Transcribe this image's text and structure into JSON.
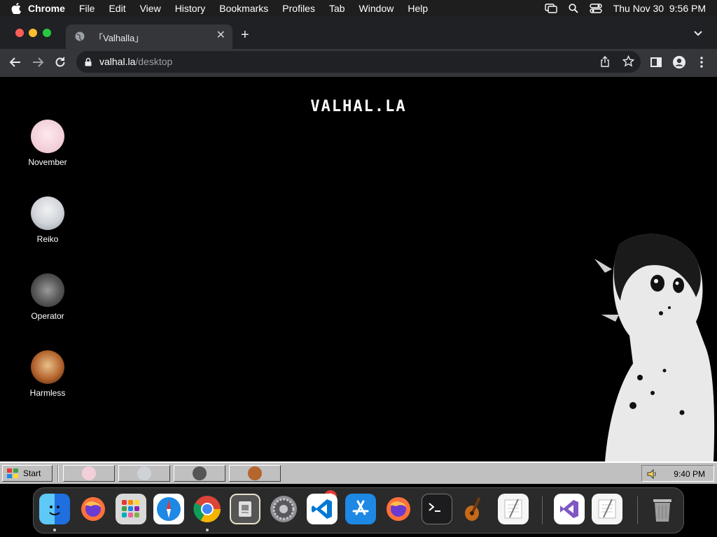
{
  "menubar": {
    "app_name": "Chrome",
    "items": [
      "File",
      "Edit",
      "View",
      "History",
      "Bookmarks",
      "Profiles",
      "Tab",
      "Window",
      "Help"
    ],
    "datetime": "Thu Nov 30  9:56 PM"
  },
  "browser": {
    "tab_title": "「Valhalla」",
    "url_host": "valhal.la",
    "url_path": "/desktop"
  },
  "page": {
    "title": "VALHAL.LA",
    "desktop_icons": [
      {
        "label": "November",
        "color": "#f3d6de"
      },
      {
        "label": "Reiko",
        "color": "#cfd3d8"
      },
      {
        "label": "Operator",
        "color": "#555555"
      },
      {
        "label": "Harmless",
        "color": "#b5652e"
      }
    ]
  },
  "taskbar": {
    "start_label": "Start",
    "clock": "9:40 PM",
    "windows": [
      "november",
      "reiko",
      "operator",
      "harmless"
    ]
  },
  "dock": {
    "apps": [
      "finder-icon",
      "firefox-icon",
      "launchpad-icon",
      "safari-icon",
      "chrome-icon",
      "preview-icon",
      "system-settings-icon",
      "vscode-icon",
      "app-store-icon",
      "firefox-icon",
      "terminal-icon",
      "garageband-icon",
      "textedit-icon",
      "visual-studio-icon",
      "textedit-icon",
      "trash-icon"
    ],
    "settings_badge": "2"
  },
  "colors": {
    "menubar": "#1e1e1e",
    "tabstrip": "#202124",
    "toolbar": "#35363a",
    "taskbar": "#c0c0c0",
    "page": "#000000"
  }
}
